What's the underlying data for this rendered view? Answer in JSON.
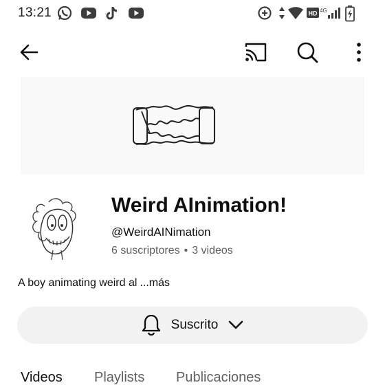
{
  "status_bar": {
    "time": "13:21",
    "notification_icons": [
      "whatsapp-icon",
      "youtube-icon",
      "tiktok-icon",
      "youtube-icon"
    ],
    "system_icons": [
      "data-saver-icon",
      "data-arrows-icon",
      "wifi-icon",
      "hd-icon",
      "signal-4g-icon",
      "battery-icon"
    ],
    "network_label": "4G",
    "hd_label": "HD"
  },
  "app_bar": {
    "back_icon": "back-arrow-icon",
    "cast_icon": "cast-icon",
    "search_icon": "search-icon",
    "menu_icon": "more-vert-icon"
  },
  "channel": {
    "name": "Weird AInimation!",
    "handle": "@WeirdAINimation",
    "subscribers": "6 suscriptores",
    "videos": "3 videos",
    "separator": "•",
    "description": "A boy animating weird al",
    "more_label": "...más"
  },
  "subscribe": {
    "label": "Suscrito",
    "bell_icon": "bell-icon",
    "chevron_icon": "chevron-down-icon"
  },
  "tabs": [
    {
      "label": "Videos",
      "active": true
    },
    {
      "label": "Playlists",
      "active": false
    },
    {
      "label": "Publicaciones",
      "active": false
    }
  ],
  "colors": {
    "primary_text": "#0f0f0f",
    "secondary_text": "#606060",
    "button_bg": "#f2f2f2",
    "banner_bg": "#f9f9f9"
  }
}
